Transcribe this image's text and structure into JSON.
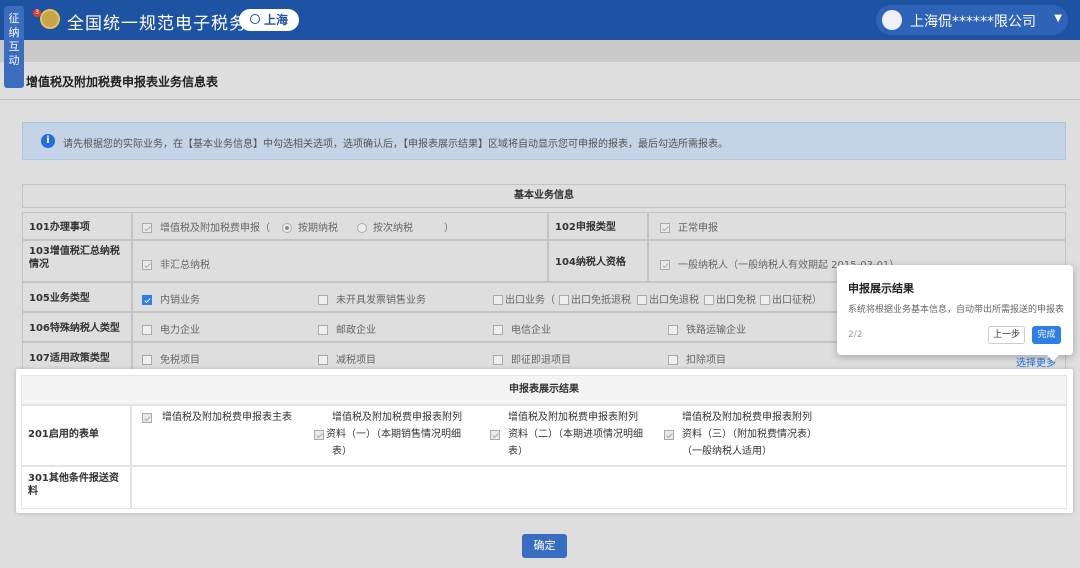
{
  "header": {
    "badge_count": "3",
    "bureau_name": "全国统一规范电子税务局",
    "region": "上海",
    "user_name": "上海侃******限公司",
    "side_tab": [
      "征",
      "纳",
      "互",
      "动"
    ]
  },
  "page": {
    "title": "增值税及附加税费申报表业务信息表",
    "info": "请先根据您的实际业务，在【基本业务信息】中勾选相关选项，选项确认后，【申报表展示结果】区域将自动显示您可申报的报表，最后勾选所需报表。",
    "confirm_label": "确定",
    "select_more": "选择更多"
  },
  "basic": {
    "heading": "基本业务信息",
    "r101": {
      "label": "101办理事项",
      "option": "增值税及附加税费申报（",
      "radio1": "按期纳税",
      "radio2": "按次纳税",
      "close": "）"
    },
    "r102": {
      "label": "102申报类型",
      "value": "正常申报"
    },
    "r103": {
      "label": "103增值税汇总纳税情况",
      "value": "非汇总纳税"
    },
    "r104": {
      "label": "104纳税人资格",
      "value": "一般纳税人（一般纳税人有效期起 2015-03-01）"
    },
    "r105": {
      "label": "105业务类型",
      "options": [
        "内销业务",
        "未开具发票销售业务",
        "出口业务（",
        "出口免抵退税",
        "出口免退税",
        "出口免税",
        "出口征税）"
      ]
    },
    "r106": {
      "label": "106特殊纳税人类型",
      "options": [
        "电力企业",
        "邮政企业",
        "电信企业",
        "铁路运输企业"
      ]
    },
    "r107": {
      "label": "107适用政策类型",
      "options": [
        "免税项目",
        "减税项目",
        "即征即退项目",
        "扣除项目"
      ]
    }
  },
  "result": {
    "heading": "申报表展示结果",
    "r201_label": "201启用的表单",
    "forms": [
      {
        "l1": "增值税及附加税费申报表主表",
        "l2": "",
        "l3": ""
      },
      {
        "l1": "增值税及附加税费申报表附列",
        "l2": "资料（一）（本期销售情况明细",
        "l3": "表）"
      },
      {
        "l1": "增值税及附加税费申报表附列",
        "l2": "资料（二）（本期进项情况明细",
        "l3": "表）"
      },
      {
        "l1": "增值税及附加税费申报表附列",
        "l2": "资料（三）（附加税费情况表）",
        "l3": "（一般纳税人适用）"
      }
    ],
    "r301_label": "301其他条件报送资料"
  },
  "popover": {
    "title": "申报展示结果",
    "desc": "系统将根据业务基本信息，自动带出所需报送的申报表",
    "counter": "2/2",
    "prev": "上一步",
    "done": "完成"
  }
}
